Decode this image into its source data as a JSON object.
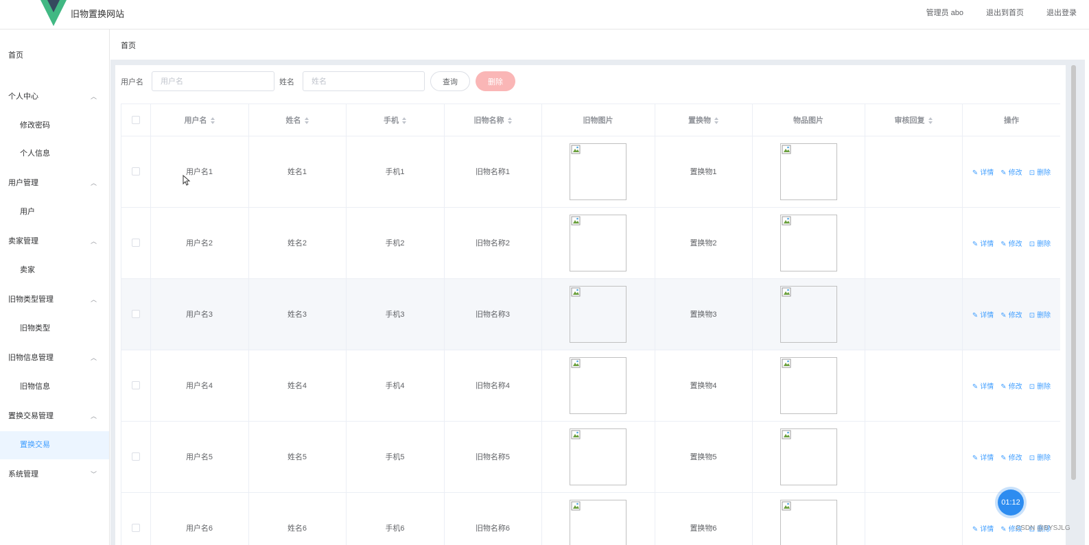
{
  "header": {
    "site_title": "旧物置换网站",
    "admin_label": "管理员 abo",
    "back_home": "退出到首页",
    "logout": "退出登录"
  },
  "sidebar": {
    "items": [
      {
        "label": "首页",
        "type": "top",
        "arrow": ""
      },
      {
        "label": "个人中心",
        "type": "top",
        "arrow": "^"
      },
      {
        "label": "修改密码",
        "type": "sub"
      },
      {
        "label": "个人信息",
        "type": "sub"
      },
      {
        "label": "用户管理",
        "type": "top",
        "arrow": "^"
      },
      {
        "label": "用户",
        "type": "sub"
      },
      {
        "label": "卖家管理",
        "type": "top",
        "arrow": "^"
      },
      {
        "label": "卖家",
        "type": "sub"
      },
      {
        "label": "旧物类型管理",
        "type": "top",
        "arrow": "^"
      },
      {
        "label": "旧物类型",
        "type": "sub"
      },
      {
        "label": "旧物信息管理",
        "type": "top",
        "arrow": "^"
      },
      {
        "label": "旧物信息",
        "type": "sub"
      },
      {
        "label": "置换交易管理",
        "type": "top",
        "arrow": "^"
      },
      {
        "label": "置换交易",
        "type": "sub",
        "active": true
      },
      {
        "label": "系统管理",
        "type": "top",
        "arrow": "v"
      }
    ]
  },
  "breadcrumb": "首页",
  "search": {
    "username_label": "用户名",
    "username_placeholder": "用户名",
    "name_label": "姓名",
    "name_placeholder": "姓名",
    "query_button": "查询",
    "delete_button": "删除"
  },
  "table": {
    "columns": [
      {
        "label": "用户名",
        "sortable": true
      },
      {
        "label": "姓名",
        "sortable": true
      },
      {
        "label": "手机",
        "sortable": true
      },
      {
        "label": "旧物名称",
        "sortable": true
      },
      {
        "label": "旧物图片",
        "sortable": false
      },
      {
        "label": "置换物",
        "sortable": true
      },
      {
        "label": "物品图片",
        "sortable": false
      },
      {
        "label": "审核回复",
        "sortable": true
      },
      {
        "label": "操作",
        "sortable": false
      }
    ],
    "actions": {
      "detail": "详情",
      "edit": "修改",
      "delete": "删除"
    },
    "rows": [
      {
        "username": "用户名1",
        "name": "姓名1",
        "phone": "手机1",
        "item_name": "旧物名称1",
        "swap_item": "置换物1",
        "review": ""
      },
      {
        "username": "用户名2",
        "name": "姓名2",
        "phone": "手机2",
        "item_name": "旧物名称2",
        "swap_item": "置换物2",
        "review": ""
      },
      {
        "username": "用户名3",
        "name": "姓名3",
        "phone": "手机3",
        "item_name": "旧物名称3",
        "swap_item": "置换物3",
        "review": "",
        "hover": true
      },
      {
        "username": "用户名4",
        "name": "姓名4",
        "phone": "手机4",
        "item_name": "旧物名称4",
        "swap_item": "置换物4",
        "review": ""
      },
      {
        "username": "用户名5",
        "name": "姓名5",
        "phone": "手机5",
        "item_name": "旧物名称5",
        "swap_item": "置换物5",
        "review": ""
      },
      {
        "username": "用户名6",
        "name": "姓名6",
        "phone": "手机6",
        "item_name": "旧物名称6",
        "swap_item": "置换物6",
        "review": ""
      }
    ]
  },
  "overlay": {
    "timer": "01:12",
    "watermark": "CSDN @BYSJLG"
  },
  "colors": {
    "primary": "#409eff",
    "danger_light": "#fab6b6",
    "logo_green": "#41b883",
    "logo_dark": "#35495e"
  }
}
